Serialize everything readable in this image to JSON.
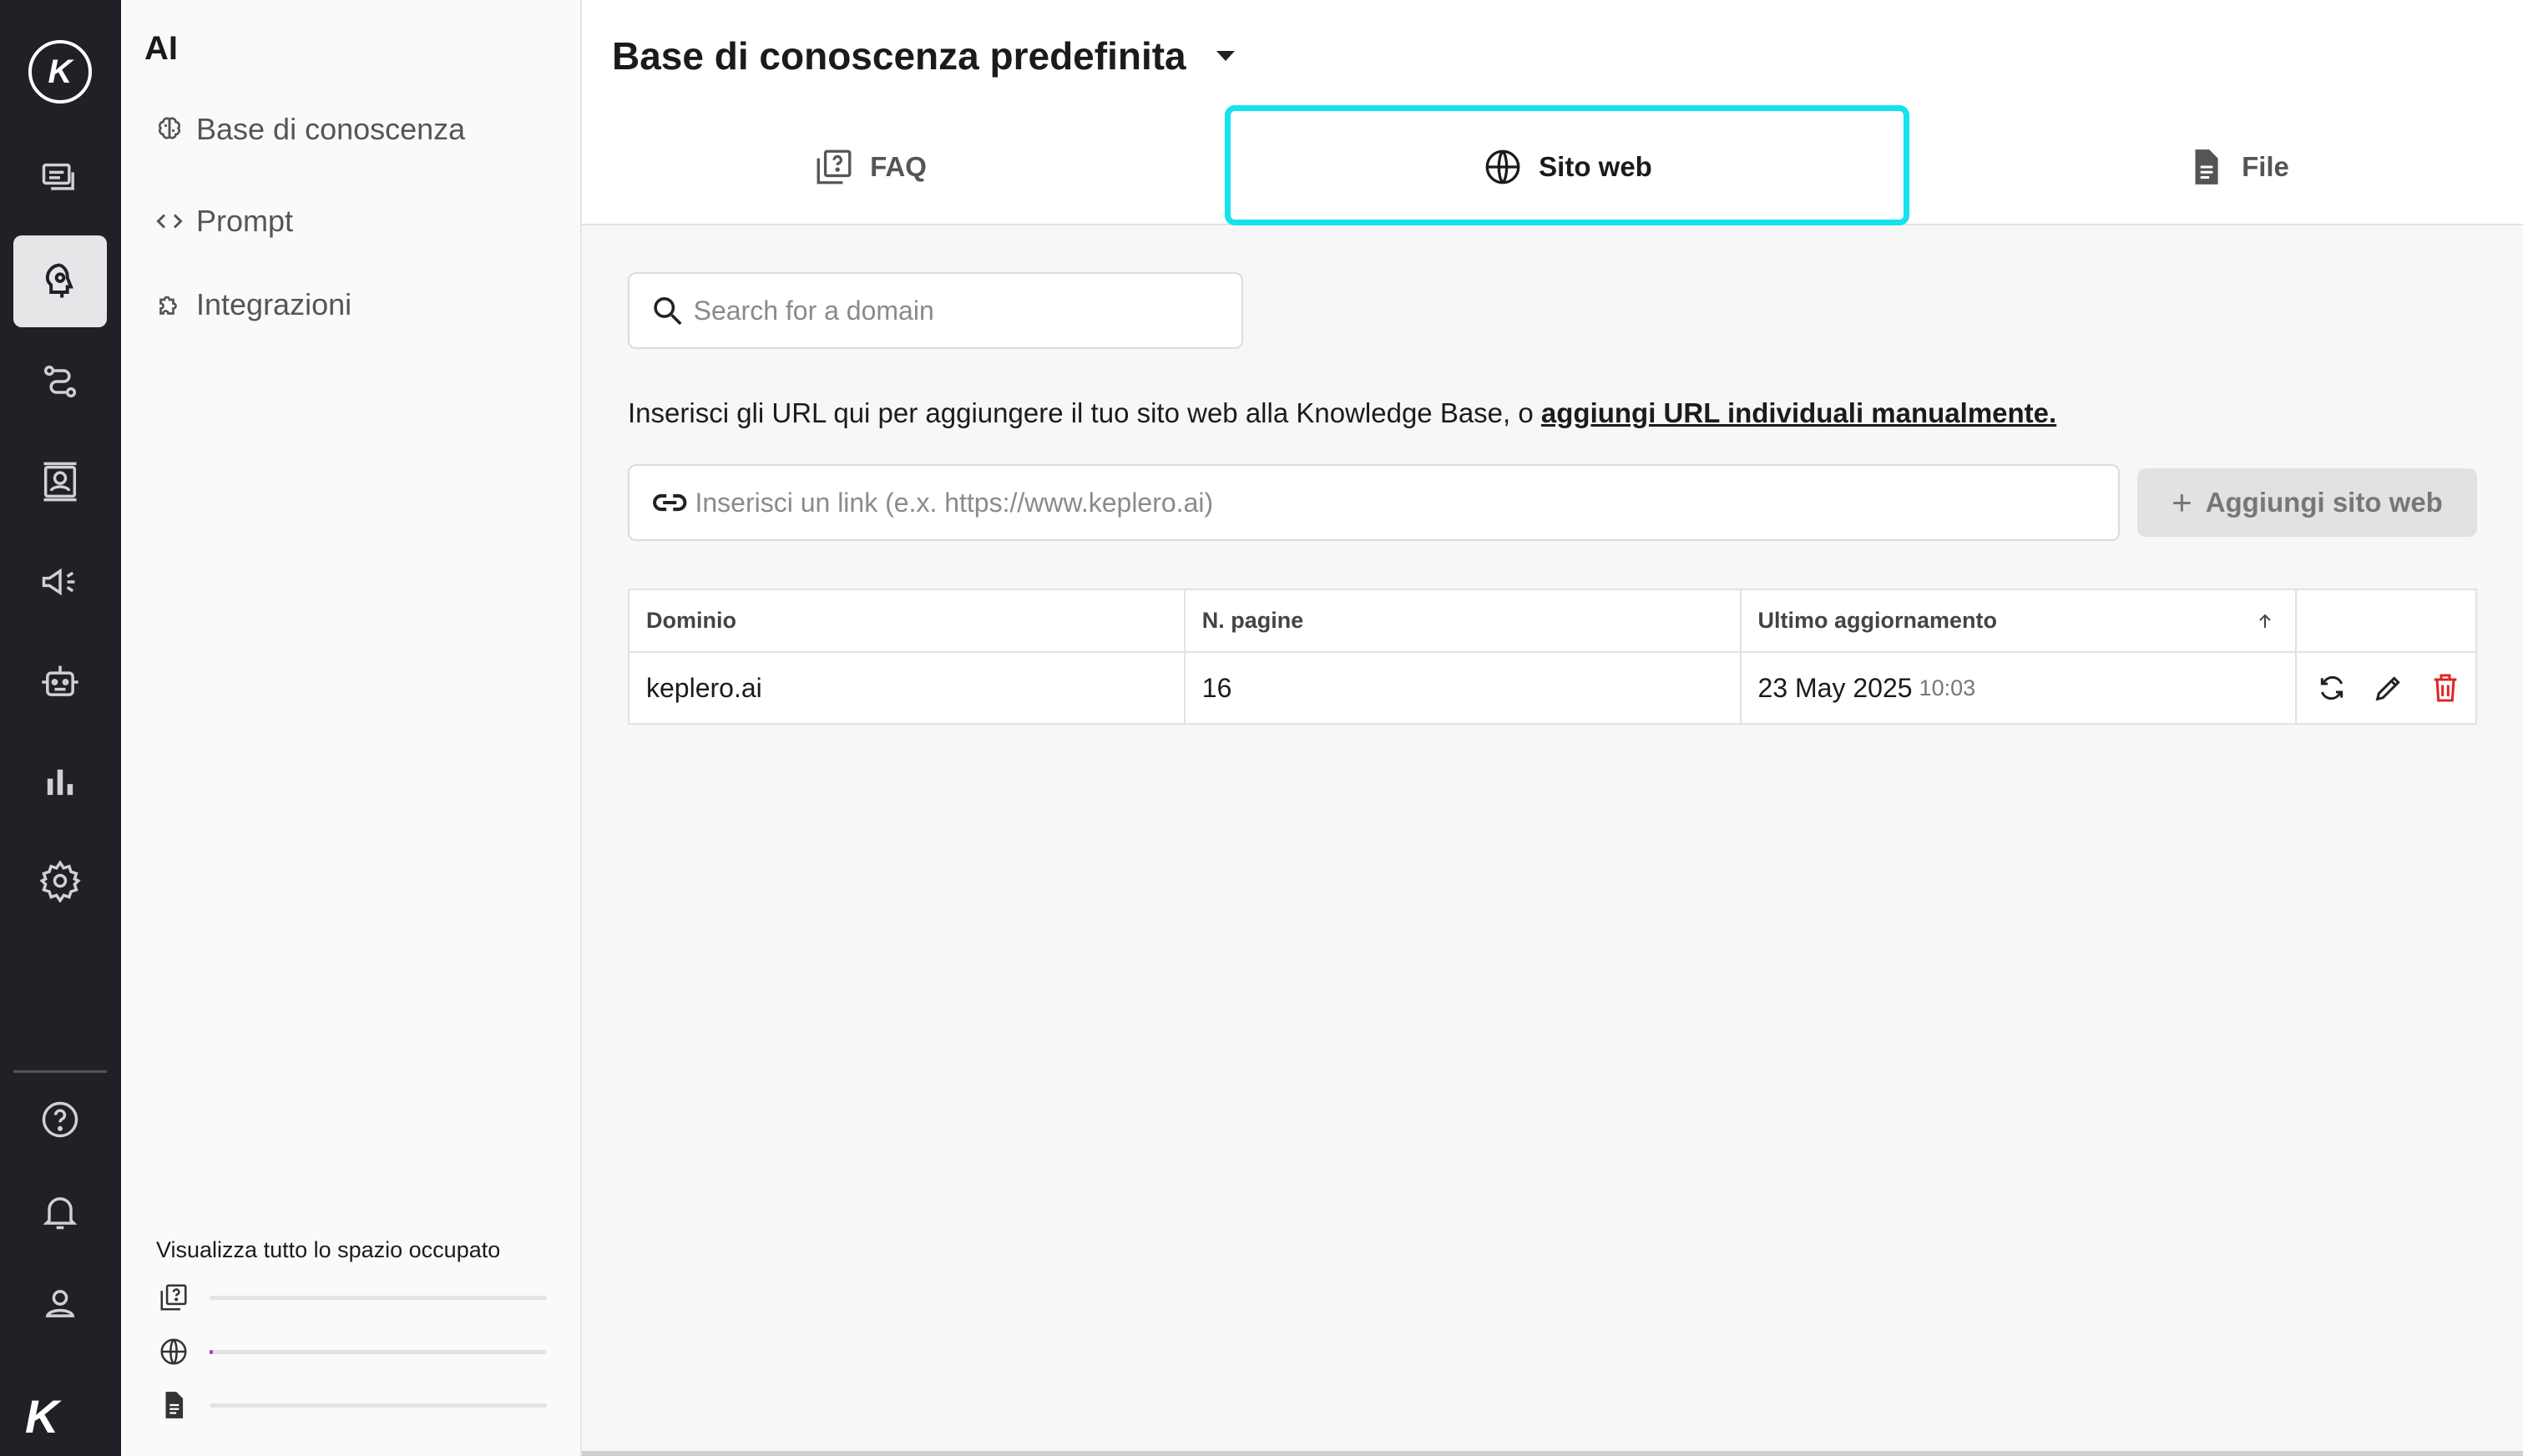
{
  "sidebar": {
    "section_title": "AI",
    "items": [
      {
        "label": "Base di conoscenza",
        "icon": "brain-icon"
      },
      {
        "label": "Prompt",
        "icon": "code-icon"
      },
      {
        "label": "Integrazioni",
        "icon": "puzzle-icon"
      }
    ],
    "storage": {
      "title": "Visualizza tutto lo spazio occupato",
      "rows": [
        {
          "icon": "faq-icon",
          "fraction": 0.0
        },
        {
          "icon": "globe-icon",
          "fraction": 0.01
        },
        {
          "icon": "file-icon",
          "fraction": 0.0
        }
      ]
    }
  },
  "rail": {
    "items": [
      "chat-icon",
      "ai-icon",
      "workflow-icon",
      "contacts-icon",
      "campaign-icon",
      "bot-icon",
      "analytics-icon",
      "settings-icon",
      "help-icon",
      "bell-icon",
      "user-icon"
    ],
    "active": "ai-icon"
  },
  "header": {
    "title": "Base di conoscenza predefinita"
  },
  "tabs": [
    {
      "label": "FAQ"
    },
    {
      "label": "Sito web",
      "active": true
    },
    {
      "label": "File"
    }
  ],
  "search": {
    "placeholder": "Search for a domain"
  },
  "info": {
    "text": "Inserisci gli URL qui per aggiungere il tuo sito web alla Knowledge Base, o ",
    "link": "aggiungi URL individuali manualmente."
  },
  "link_input": {
    "placeholder": "Inserisci un link (e.x. https://www.keplero.ai)"
  },
  "add_button": {
    "label": "Aggiungi sito web"
  },
  "table": {
    "headers": [
      "Dominio",
      "N. pagine",
      "Ultimo aggiornamento"
    ],
    "rows": [
      {
        "domain": "keplero.ai",
        "pages": "16",
        "date": "23 May 2025",
        "time": "10:03"
      }
    ]
  },
  "colors": {
    "highlight": "#14e3ee",
    "rail": "#1f2127",
    "delete": "#e02424"
  }
}
